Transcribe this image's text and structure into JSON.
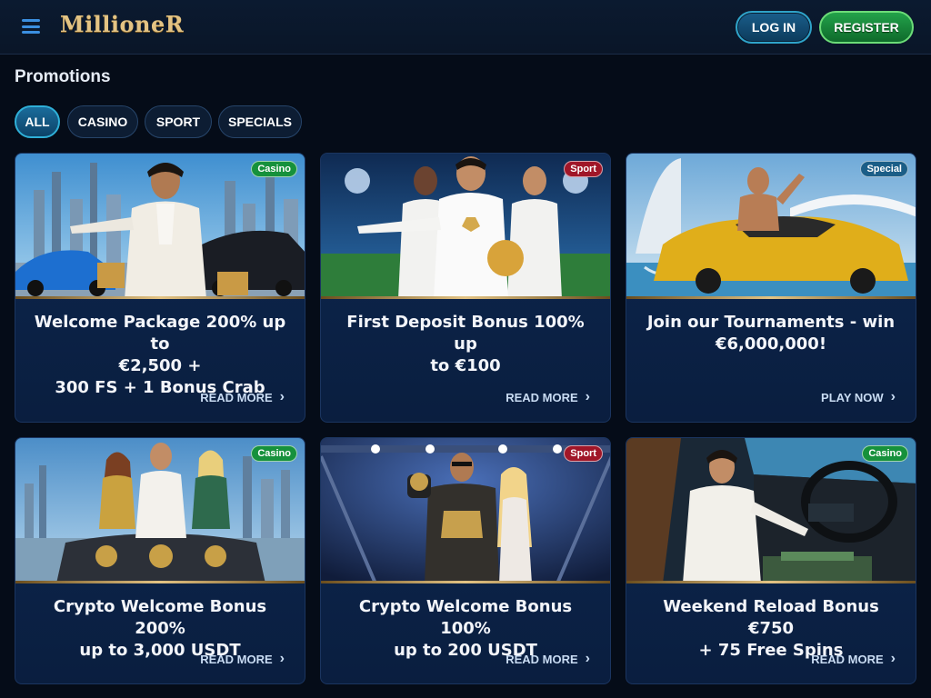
{
  "header": {
    "logo": "MillioneR",
    "login_label": "LOG IN",
    "register_label": "REGISTER"
  },
  "page": {
    "title": "Promotions"
  },
  "tabs": [
    {
      "label": "ALL",
      "active": true
    },
    {
      "label": "CASINO",
      "active": false
    },
    {
      "label": "SPORT",
      "active": false
    },
    {
      "label": "SPECIALS",
      "active": false
    }
  ],
  "promotions": [
    {
      "badge": "Casino",
      "title": "Welcome Package 200% up to\n€2,500 +\n300 FS + 1 Bonus Crab",
      "cta": "READ MORE"
    },
    {
      "badge": "Sport",
      "title": "First Deposit Bonus 100% up\nto €100",
      "cta": "READ MORE"
    },
    {
      "badge": "Special",
      "title": "Join our Tournaments - win\n€6,000,000!",
      "cta": "PLAY NOW"
    },
    {
      "badge": "Casino",
      "title": "Crypto Welcome Bonus 200%\nup to 3,000 USDT",
      "cta": "READ MORE"
    },
    {
      "badge": "Sport",
      "title": "Crypto Welcome Bonus 100%\nup to 200 USDT",
      "cta": "READ MORE"
    },
    {
      "badge": "Casino",
      "title": "Weekend Reload Bonus €750\n+ 75 Free Spins",
      "cta": "READ MORE"
    }
  ],
  "colors": {
    "background": "#050c18",
    "card": "#0d2750",
    "gold": "#e3c383",
    "casino_badge": "#16913c",
    "sport_badge": "#a01628",
    "special_badge": "#1b5e87"
  },
  "icons": {
    "menu": "hamburger-icon",
    "chevron": "chevron-right-icon"
  }
}
